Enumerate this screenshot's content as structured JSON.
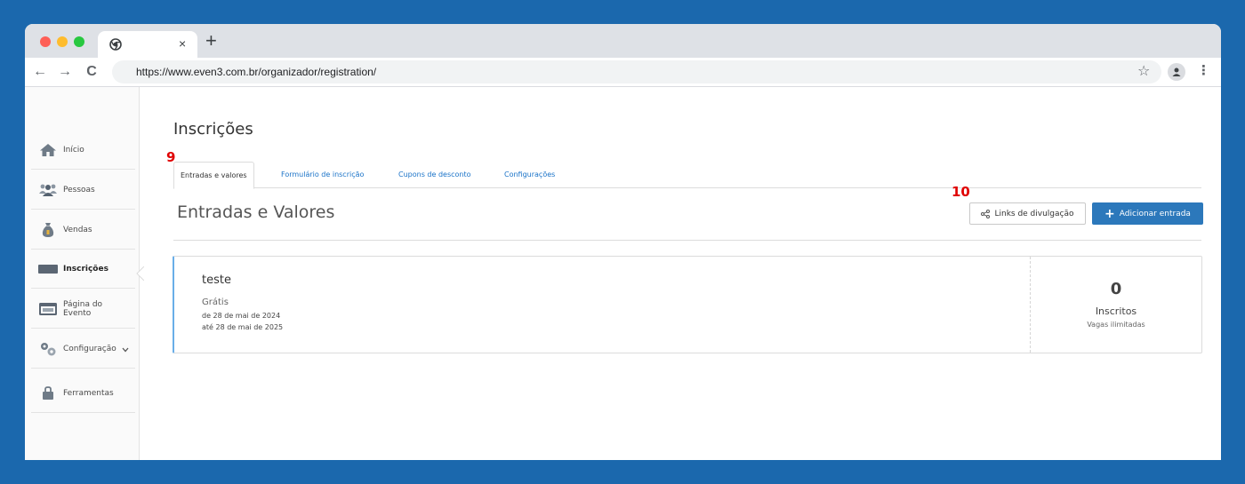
{
  "browser": {
    "tab_close_glyph": "×",
    "new_tab_glyph": "+",
    "url": "https://www.even3.com.br/organizador/registration/",
    "back_glyph": "←",
    "forward_glyph": "→",
    "reload_glyph": "C",
    "star_glyph": "☆",
    "menu_glyph": "⋮"
  },
  "sidebar": {
    "items": [
      {
        "label": "Início",
        "icon": "home-icon"
      },
      {
        "label": "Pessoas",
        "icon": "people-icon"
      },
      {
        "label": "Vendas",
        "icon": "money-bag-icon"
      },
      {
        "label": "Inscrições",
        "icon": "ticket-icon"
      },
      {
        "label": "Página do Evento",
        "icon": "browser-window-icon"
      },
      {
        "label": "Configuração",
        "icon": "gears-icon"
      },
      {
        "label": "Ferramentas",
        "icon": "toolbox-icon"
      }
    ]
  },
  "main": {
    "page_title": "Inscrições",
    "tabs": [
      {
        "label": "Entradas e valores"
      },
      {
        "label": "Formulário de inscrição"
      },
      {
        "label": "Cupons de desconto"
      },
      {
        "label": "Configurações"
      }
    ],
    "section_title": "Entradas e Valores",
    "links_button_label": "Links de divulgação",
    "add_button_label": "Adicionar entrada",
    "add_button_glyph": "+",
    "entry": {
      "name": "teste",
      "price": "Grátis",
      "from": "de 28 de mai de 2024",
      "to": "até 28 de mai de 2025",
      "count": "0",
      "count_label": "Inscritos",
      "slots": "Vagas ilimitadas"
    }
  },
  "annotations": {
    "step_9": "9",
    "step_10": "10"
  },
  "colors": {
    "page_background": "#1b68ad",
    "primary_button": "#2c78bb",
    "tab_link": "#1a73c8",
    "annotation_red": "#e00000"
  }
}
